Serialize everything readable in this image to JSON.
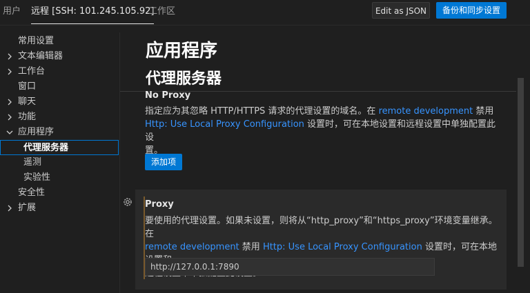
{
  "tabs": [
    {
      "label": "用户"
    },
    {
      "label": "远程 [SSH: 101.245.105.92]"
    },
    {
      "label": "工作区"
    }
  ],
  "toolbar": {
    "edit_json": "Edit as JSON",
    "sync": "备份和同步设置"
  },
  "sidebar": {
    "items": [
      {
        "label": "常用设置"
      },
      {
        "label": "文本编辑器"
      },
      {
        "label": "工作台"
      },
      {
        "label": "窗口"
      },
      {
        "label": "聊天"
      },
      {
        "label": "功能"
      },
      {
        "label": "应用程序"
      },
      {
        "label": "代理服务器"
      },
      {
        "label": "遥测"
      },
      {
        "label": "实验性"
      },
      {
        "label": "安全性"
      },
      {
        "label": "扩展"
      }
    ]
  },
  "main": {
    "section_title": "应用程序",
    "subsection_title": "代理服务器",
    "no_proxy": {
      "title": "No Proxy",
      "desc_line1_a": "指定应为其忽略 HTTP/HTTPS 请求的代理设置的域名。在 ",
      "desc_line1_link": "remote development",
      "desc_line1_b": " 禁用",
      "desc_line2_link": "Http: Use Local Proxy Configuration",
      "desc_line2_b": " 设置时，可在本地设置和远程设置中单独配置此设",
      "desc_line3": "置。",
      "add_button": "添加项"
    },
    "proxy": {
      "title": "Proxy",
      "desc_line1": "要使用的代理设置。如果未设置，则将从“http_proxy”和“https_proxy”环境变量继承。在",
      "desc_line2_link_a": "remote development",
      "desc_line2_mid": " 禁用 ",
      "desc_line2_link_b": "Http: Use Local Proxy Configuration",
      "desc_line2_end": " 设置时，可在本地设置和",
      "desc_line3": "远程设置中单独配置此设置。",
      "value": "http://127.0.0.1:7890"
    }
  }
}
